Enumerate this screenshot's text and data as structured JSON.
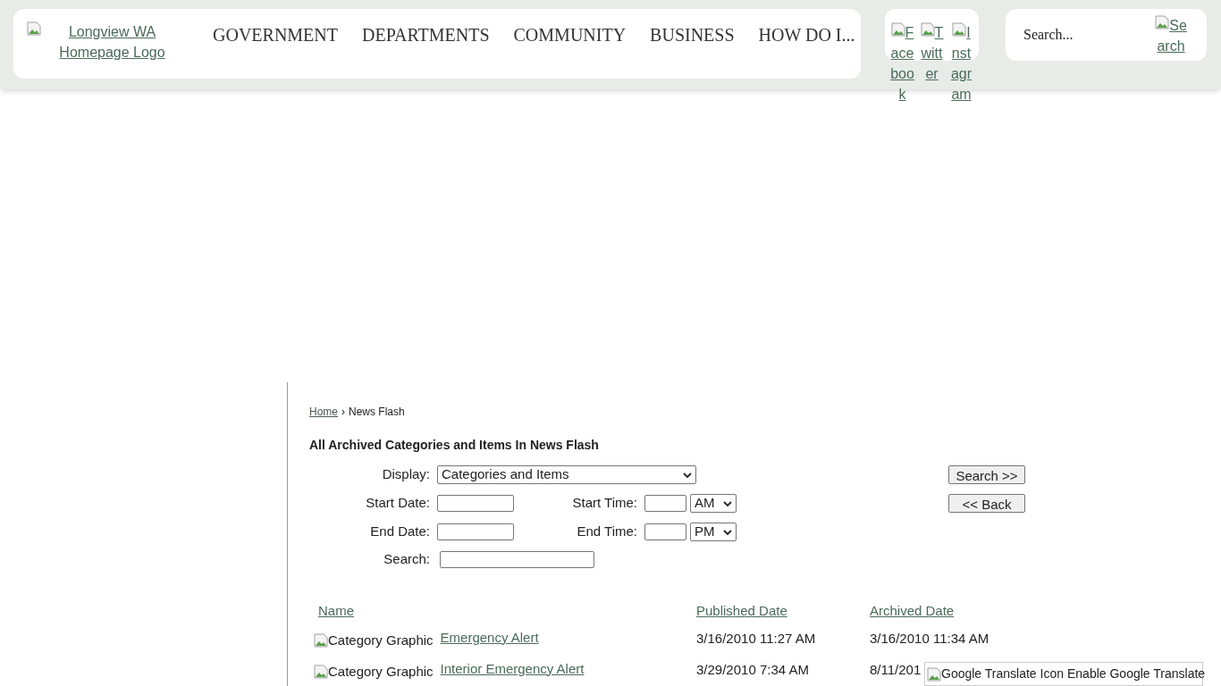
{
  "header": {
    "logo_alt": "Longview WA Homepage Logo",
    "nav": [
      "GOVERNMENT",
      "DEPARTMENTS",
      "COMMUNITY",
      "BUSINESS",
      "HOW DO I..."
    ],
    "social": [
      "Facebook",
      "Twitter",
      "Instagram"
    ],
    "search": {
      "placeholder": "Search...",
      "button_alt": "Search"
    }
  },
  "breadcrumb": {
    "home": "Home",
    "separator": "›",
    "current": "News Flash"
  },
  "title": "All Archived Categories and Items In News Flash",
  "form": {
    "display_label": "Display:",
    "display_value": "Categories and Items",
    "start_date_label": "Start Date:",
    "start_time_label": "Start Time:",
    "start_ampm": "AM",
    "end_date_label": "End Date:",
    "end_time_label": "End Time:",
    "end_ampm": "PM",
    "search_label": "Search:",
    "search_button": "Search >>",
    "back_button": "<< Back"
  },
  "table": {
    "columns": [
      "Name",
      "Published Date",
      "Archived Date"
    ],
    "rows": [
      {
        "image_alt": "Category Graphic",
        "name": "Emergency Alert",
        "published": "3/16/2010 11:27 AM",
        "archived": "3/16/2010 11:34 AM"
      },
      {
        "image_alt": "Category Graphic",
        "name": "Interior Emergency Alert",
        "published": "3/29/2010 7:34 AM",
        "archived": "8/11/201"
      }
    ]
  },
  "translate": {
    "icon_alt": "Google Translate Icon",
    "label": "Enable Google Translate"
  }
}
